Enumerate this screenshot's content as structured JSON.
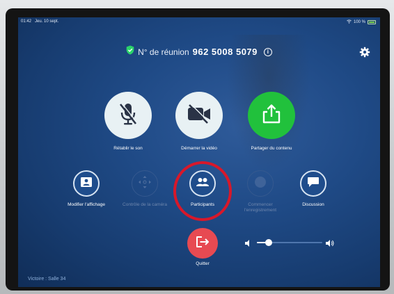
{
  "status": {
    "time": "01:42",
    "date": "Jeu. 10 sept.",
    "battery": "100 %"
  },
  "meeting": {
    "label": "N° de réunion",
    "number": "962 5008 5079",
    "info_symbol": "i"
  },
  "primary_buttons": [
    {
      "label": "Rétablir le son",
      "icon": "muted-microphone-icon"
    },
    {
      "label": "Démarrer la vidéo",
      "icon": "video-off-icon"
    },
    {
      "label": "Partager du contenu",
      "icon": "share-upload-icon"
    }
  ],
  "secondary_buttons": [
    {
      "label": "Modifier l'affichage",
      "icon": "layout-icon",
      "enabled": true
    },
    {
      "label": "Contrôle de la caméra",
      "icon": "camera-control-icon",
      "enabled": false
    },
    {
      "label": "Participants",
      "icon": "participants-icon",
      "enabled": true
    },
    {
      "label": "Commencer l'enregistrement",
      "icon": "record-icon",
      "enabled": false
    },
    {
      "label": "Discussion",
      "icon": "chat-icon",
      "enabled": true
    }
  ],
  "quit": {
    "label": "Quitter",
    "icon": "leave-icon"
  },
  "volume": {
    "level": 0.18
  },
  "room": {
    "name": "Victoire : Salle 34"
  },
  "colors": {
    "background": "#1f4a86",
    "share_green": "#21c13c",
    "quit_red": "#e74a52",
    "highlight_ring": "#d8182a"
  }
}
